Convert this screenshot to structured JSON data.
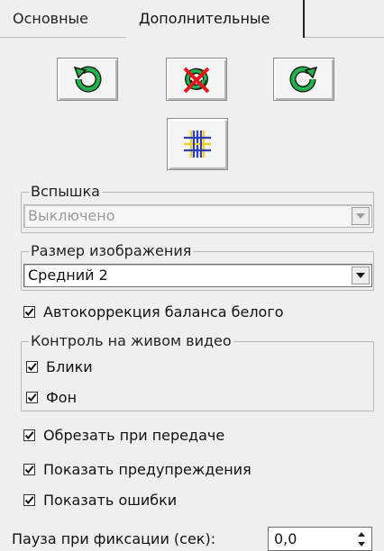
{
  "tabs": [
    {
      "label": "Основные",
      "active": false
    },
    {
      "label": "Дополнительные",
      "active": true
    }
  ],
  "toolbar": {
    "rotate_left_icon": "rotate-ccw-icon",
    "reset_icon": "reset-rotation-icon",
    "rotate_right_icon": "rotate-cw-icon",
    "grid_icon": "grid-icon"
  },
  "flash": {
    "legend": "Вспышка",
    "value": "Выключено",
    "enabled": false
  },
  "image_size": {
    "legend": "Размер изображения",
    "value": "Средний 2"
  },
  "auto_wb": {
    "label": "Автокоррекция баланса белого",
    "checked": true
  },
  "live_view": {
    "legend": "Контроль на живом видео",
    "highlights": {
      "label": "Блики",
      "checked": true
    },
    "background": {
      "label": "Фон",
      "checked": true
    }
  },
  "crop_transfer": {
    "label": "Обрезать при передаче",
    "checked": true
  },
  "show_warnings": {
    "label": "Показать предупреждения",
    "checked": true
  },
  "show_errors": {
    "label": "Показать ошибки",
    "checked": true
  },
  "pause": {
    "label": "Пауза при фиксации (сек):",
    "value": "0,0"
  },
  "colors": {
    "green": "#22b14c",
    "red": "#e8161b",
    "grid_blue": "#2f3fb3",
    "grid_yellow": "#f0d21a"
  }
}
